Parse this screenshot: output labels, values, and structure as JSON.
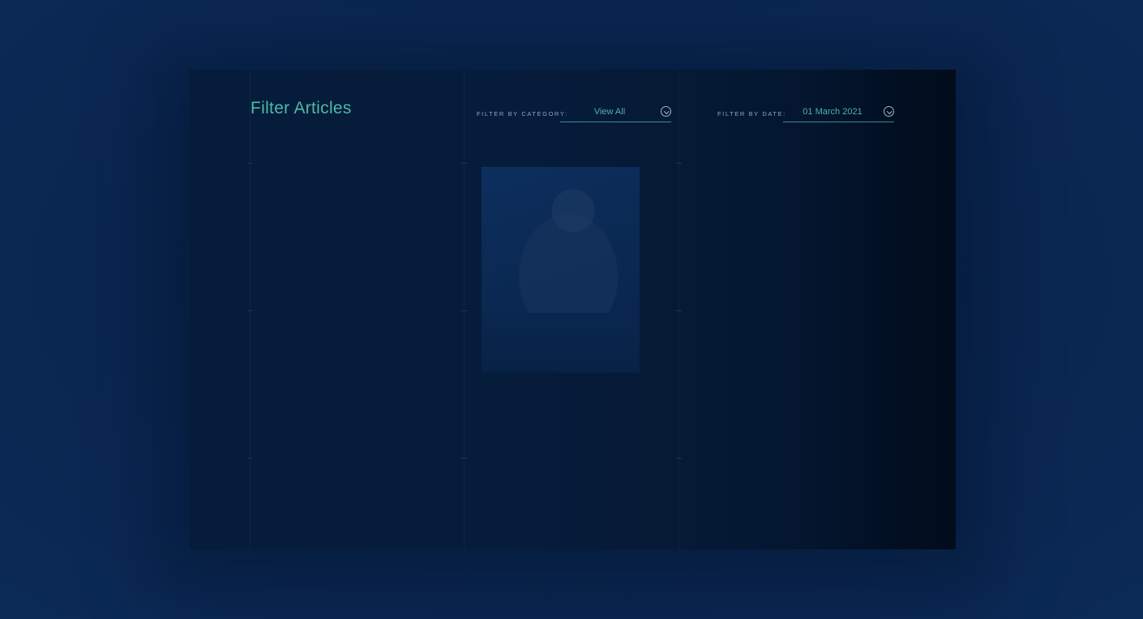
{
  "page": {
    "title": "Filter Articles"
  },
  "filters": {
    "category": {
      "label": "FILTER BY CATEGORY:",
      "value": "View All",
      "icon": "chevron-down-circle-icon"
    },
    "date": {
      "label": "FILTER BY DATE:",
      "value": "01 March 2021",
      "icon": "chevron-down-circle-icon"
    }
  },
  "article_card": {
    "headline": "",
    "meta_left": "",
    "meta_right": ""
  },
  "colors": {
    "accent": "#4fb8a8",
    "background": "#0b2a55",
    "panel": "#061c3b"
  }
}
